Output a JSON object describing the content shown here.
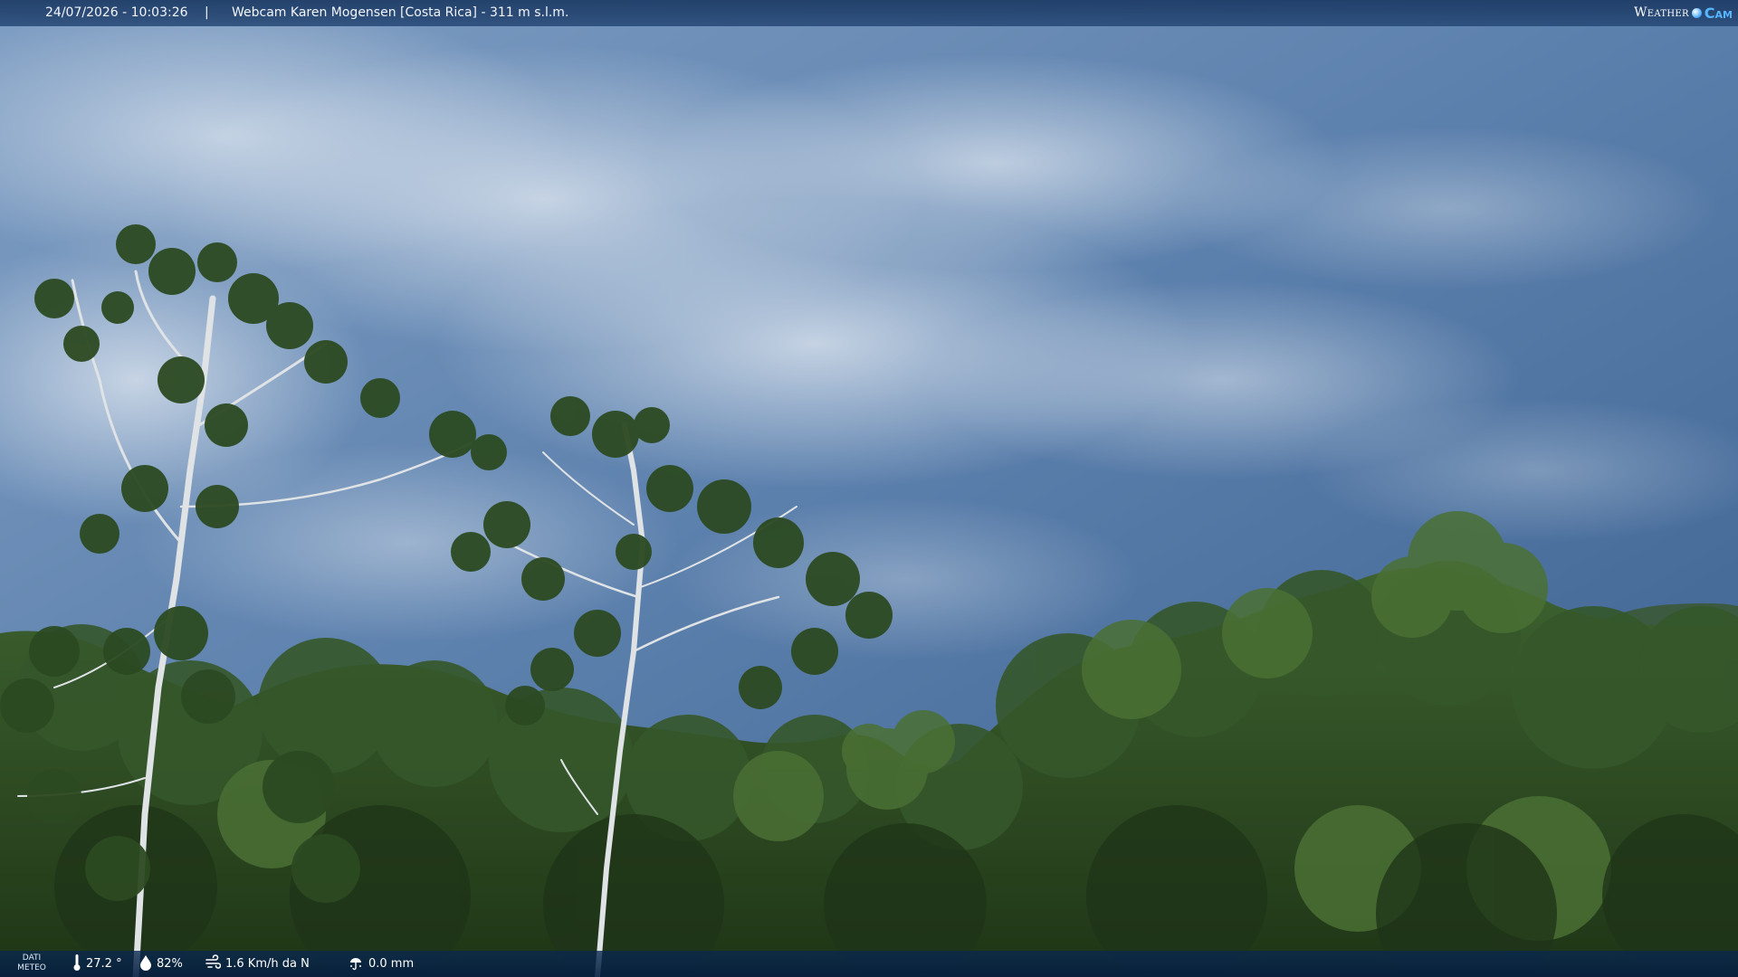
{
  "header": {
    "datetime": "24/07/2026 - 10:03:26",
    "separator": "|",
    "title": "Webcam Karen Mogensen [Costa Rica] - 311 m s.l.m.",
    "logo_left": "Weather",
    "logo_right": "Cam"
  },
  "footer": {
    "label_line1": "DATI",
    "label_line2": "METEO",
    "temperature": "27.2 °",
    "humidity": "82%",
    "wind": "1.6 Km/h da N",
    "rain": "0.0 mm"
  },
  "icons": {
    "temperature": "thermometer-icon",
    "humidity": "drop-icon",
    "wind": "wind-icon",
    "rain": "rain-gauge-icon"
  },
  "colors": {
    "sky": "#3f6290",
    "cloud": "#c9d6e6",
    "foliage": "#2b4a1f",
    "bar": "#1e3e6a",
    "logo_accent": "#57b6ff"
  }
}
